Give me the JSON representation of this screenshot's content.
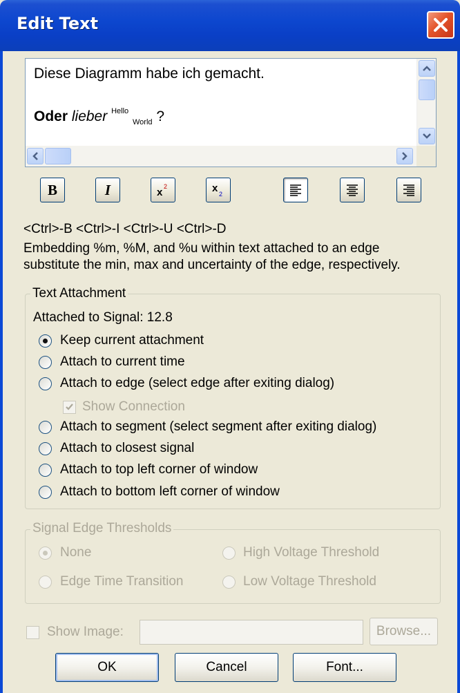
{
  "window": {
    "title": "Edit Text"
  },
  "editor": {
    "line1": "Diese Diagramm habe ich gemacht.",
    "line2_bold": "Oder",
    "line2_italic": "lieber",
    "line2_sup": "Hello",
    "line2_sub": "World",
    "line2_end": " ?"
  },
  "toolbar": {
    "bold_label": "B",
    "italic_label": "I"
  },
  "shortcuts_text": "<Ctrl>-B <Ctrl>-I <Ctrl>-U <Ctrl>-D",
  "help_line1": "Embedding %m, %M, and %u  within text attached to an edge",
  "help_line2": "substitute the min, max and uncertainty of the edge, respectively.",
  "text_attachment": {
    "title": "Text Attachment",
    "attached_label": "Attached to Signal:  12.8",
    "options": [
      "Keep current attachment",
      "Attach to current time",
      "Attach to edge (select edge after exiting dialog)",
      "Attach to segment (select segment after exiting dialog)",
      "Attach to closest signal",
      "Attach to top left corner of window",
      "Attach to bottom left corner of window"
    ],
    "selected_index": 0,
    "show_connection_label": "Show Connection",
    "show_connection_checked": true
  },
  "signal_edge": {
    "title": "Signal Edge Thresholds",
    "opt_none": "None",
    "opt_high": "High Voltage Threshold",
    "opt_edge_time": "Edge Time Transition",
    "opt_low": "Low Voltage Threshold"
  },
  "image": {
    "show_label": "Show Image:",
    "path_value": "",
    "browse_label": "Browse..."
  },
  "buttons": {
    "ok": "OK",
    "cancel": "Cancel",
    "font": "Font..."
  }
}
